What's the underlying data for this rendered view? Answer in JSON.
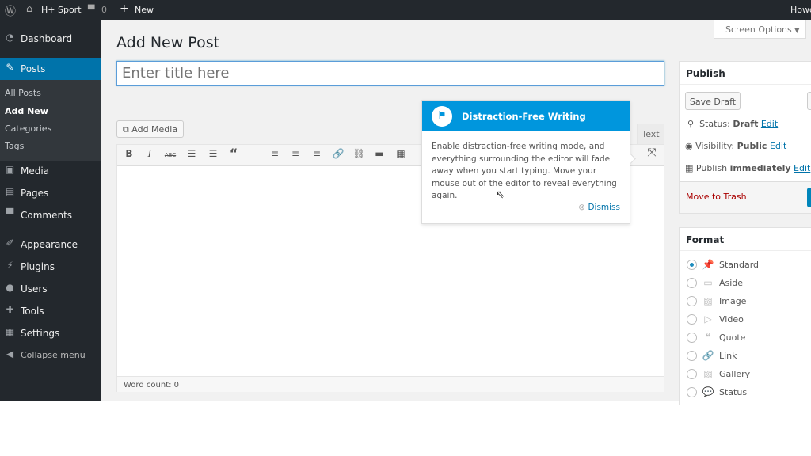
{
  "adminbar": {
    "site": "H+ Sport",
    "comments": "0",
    "new": "New",
    "howdy": "Howdy"
  },
  "sidebar": {
    "items": [
      {
        "label": "Dashboard",
        "icon": "dashboard-icon"
      },
      {
        "label": "Posts",
        "icon": "pin-icon"
      },
      {
        "label": "Media",
        "icon": "media-icon"
      },
      {
        "label": "Pages",
        "icon": "pages-icon"
      },
      {
        "label": "Comments",
        "icon": "comment-icon"
      },
      {
        "label": "Appearance",
        "icon": "brush-icon"
      },
      {
        "label": "Plugins",
        "icon": "plugin-icon"
      },
      {
        "label": "Users",
        "icon": "user-icon"
      },
      {
        "label": "Tools",
        "icon": "wrench-icon"
      },
      {
        "label": "Settings",
        "icon": "settings-icon"
      },
      {
        "label": "Collapse menu",
        "icon": "collapse-icon"
      }
    ],
    "posts_sub": [
      "All Posts",
      "Add New",
      "Categories",
      "Tags"
    ]
  },
  "main": {
    "title": "Add New Post",
    "screen_options": "Screen Options",
    "title_placeholder": "Enter title here",
    "add_media": "Add Media",
    "text_tab": "Text",
    "word_count": "Word count: 0"
  },
  "tooltip": {
    "title": "Distraction-Free Writing",
    "body": "Enable distraction-free writing mode, and everything surrounding the editor will fade away when you start typing. Move your mouse out of the editor to reveal everything again.",
    "dismiss": "Dismiss"
  },
  "publish": {
    "title": "Publish",
    "save_draft": "Save Draft",
    "status_label": "Status:",
    "status": "Draft",
    "visibility_label": "Visibility:",
    "visibility": "Public",
    "publish_label": "Publish",
    "publish_when": "immediately",
    "edit": "Edit",
    "trash": "Move to Trash"
  },
  "format": {
    "title": "Format",
    "options": [
      "Standard",
      "Aside",
      "Image",
      "Video",
      "Quote",
      "Link",
      "Gallery",
      "Status"
    ],
    "selected": "Standard"
  },
  "colors": {
    "accent": "#0073aa",
    "tooltip_header": "#0096dd",
    "adminbar": "#23282d"
  }
}
